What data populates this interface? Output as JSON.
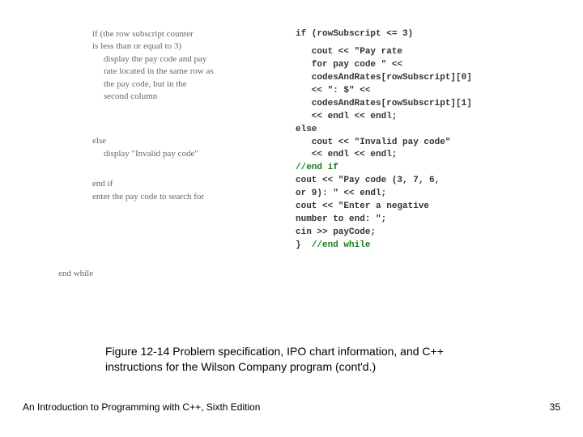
{
  "pseudo": {
    "l1": "if (the row subscript counter",
    "l2": "is less than or equal to 3)",
    "l3": "display the pay code and pay",
    "l4": "rate located in the same row as",
    "l5": "the pay code, but in the",
    "l6": "second column",
    "l7": "else",
    "l8": "display \"Invalid pay code\"",
    "l9": "end if",
    "l10": "enter the pay code to search for",
    "l11": "end while"
  },
  "code": {
    "c1": "if (rowSubscript <= 3)",
    "c2": "   cout << \"Pay rate",
    "c3": "   for pay code \" <<",
    "c4": "   codesAndRates[rowSubscript][0]",
    "c5": "   << \": $\" <<",
    "c6": "   codesAndRates[rowSubscript][1]",
    "c7": "   << endl << endl;",
    "c8": "else",
    "c9": "   cout << \"Invalid pay code\"",
    "c10": "   << endl << endl;",
    "c11": "//end if",
    "c12": "cout << \"Pay code (3, 7, 6,",
    "c13": "or 9): \" << endl;",
    "c14": "cout << \"Enter a negative",
    "c15": "number to end: \";",
    "c16": "cin >> payCode;",
    "c17a": "}  ",
    "c17b": "//end while"
  },
  "caption": "Figure 12-14 Problem specification, IPO chart information, and C++ instructions for the Wilson Company program (cont'd.)",
  "footer": {
    "book": "An Introduction to Programming with C++, Sixth Edition",
    "page": "35"
  }
}
